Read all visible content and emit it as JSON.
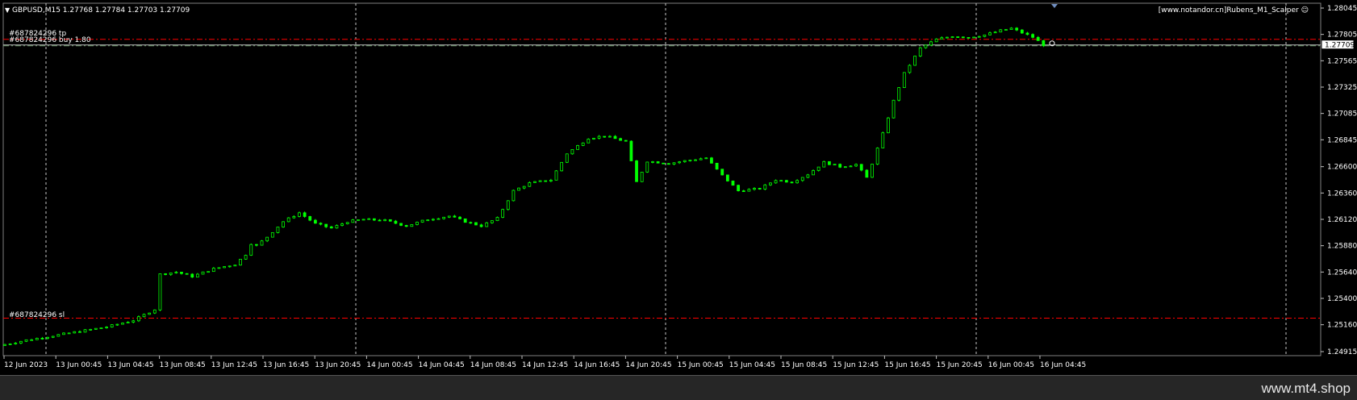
{
  "window": {
    "symbol_line": "GBPUSD,M15  1.27768 1.27784 1.27703 1.27709",
    "expert_label": "[www.notandor.cn]Rubens_M1_Scalper"
  },
  "orders": {
    "tp_label": "#687824296 tp",
    "buy_label": "#687824296 buy 1.80",
    "sl_label": "#687824296 sl",
    "tp_price": 1.2776,
    "buy_price": 1.27709,
    "sl_price": 1.2522
  },
  "current_price_label": "1.27709",
  "footer": {
    "text": "www.mt4.shop"
  },
  "colors": {
    "background": "#000000",
    "candle": "#00ff00",
    "grid": "#c8c8c8",
    "order_line": "#ff0000",
    "price_line": "#c0c0c0",
    "price_label_bg": "#ffffff"
  },
  "chart_data": {
    "type": "candlestick",
    "symbol": "GBPUSD",
    "timeframe": "M15",
    "y_ticks": [
      1.28045,
      1.27805,
      1.27565,
      1.27325,
      1.27085,
      1.26845,
      1.266,
      1.2636,
      1.2612,
      1.2588,
      1.2564,
      1.254,
      1.2516,
      1.24915
    ],
    "x_ticks": [
      "12 Jun 2023",
      "13 Jun 00:45",
      "13 Jun 04:45",
      "13 Jun 08:45",
      "13 Jun 12:45",
      "13 Jun 16:45",
      "13 Jun 20:45",
      "14 Jun 00:45",
      "14 Jun 04:45",
      "14 Jun 08:45",
      "14 Jun 12:45",
      "14 Jun 16:45",
      "14 Jun 20:45",
      "15 Jun 00:45",
      "15 Jun 04:45",
      "15 Jun 08:45",
      "15 Jun 12:45",
      "15 Jun 16:45",
      "15 Jun 20:45",
      "16 Jun 00:45",
      "16 Jun 04:45"
    ],
    "ylim": [
      1.24915,
      1.28045
    ],
    "close_path": [
      [
        0,
        1.2497
      ],
      [
        5,
        1.2502
      ],
      [
        10,
        1.2506
      ],
      [
        15,
        1.251
      ],
      [
        20,
        1.2514
      ],
      [
        25,
        1.252
      ],
      [
        29,
        1.253
      ],
      [
        30,
        1.2562
      ],
      [
        33,
        1.2564
      ],
      [
        36,
        1.256
      ],
      [
        40,
        1.2567
      ],
      [
        44,
        1.2571
      ],
      [
        46,
        1.258
      ],
      [
        47,
        1.259
      ],
      [
        48,
        1.2588
      ],
      [
        50,
        1.2596
      ],
      [
        53,
        1.261
      ],
      [
        56,
        1.2618
      ],
      [
        59,
        1.2608
      ],
      [
        62,
        1.2604
      ],
      [
        65,
        1.261
      ],
      [
        68,
        1.2612
      ],
      [
        72,
        1.2611
      ],
      [
        76,
        1.2606
      ],
      [
        80,
        1.2612
      ],
      [
        84,
        1.2615
      ],
      [
        87,
        1.261
      ],
      [
        90,
        1.2606
      ],
      [
        93,
        1.2613
      ],
      [
        96,
        1.2638
      ],
      [
        99,
        1.2645
      ],
      [
        103,
        1.2648
      ],
      [
        106,
        1.2672
      ],
      [
        110,
        1.2686
      ],
      [
        113,
        1.2688
      ],
      [
        117,
        1.2683
      ],
      [
        119,
        1.2646
      ],
      [
        121,
        1.2665
      ],
      [
        125,
        1.2663
      ],
      [
        129,
        1.2666
      ],
      [
        132,
        1.2668
      ],
      [
        135,
        1.2652
      ],
      [
        138,
        1.2638
      ],
      [
        142,
        1.264
      ],
      [
        145,
        1.2648
      ],
      [
        148,
        1.2646
      ],
      [
        151,
        1.2653
      ],
      [
        154,
        1.2664
      ],
      [
        157,
        1.266
      ],
      [
        160,
        1.2662
      ],
      [
        162,
        1.265
      ],
      [
        163,
        1.2663
      ],
      [
        165,
        1.269
      ],
      [
        167,
        1.272
      ],
      [
        169,
        1.2745
      ],
      [
        172,
        1.2768
      ],
      [
        175,
        1.2776
      ],
      [
        178,
        1.2779
      ],
      [
        181,
        1.2778
      ],
      [
        184,
        1.278
      ],
      [
        187,
        1.2784
      ],
      [
        189,
        1.2786
      ],
      [
        191,
        1.2782
      ],
      [
        193,
        1.2778
      ],
      [
        195,
        1.27709
      ]
    ],
    "grid": true
  }
}
